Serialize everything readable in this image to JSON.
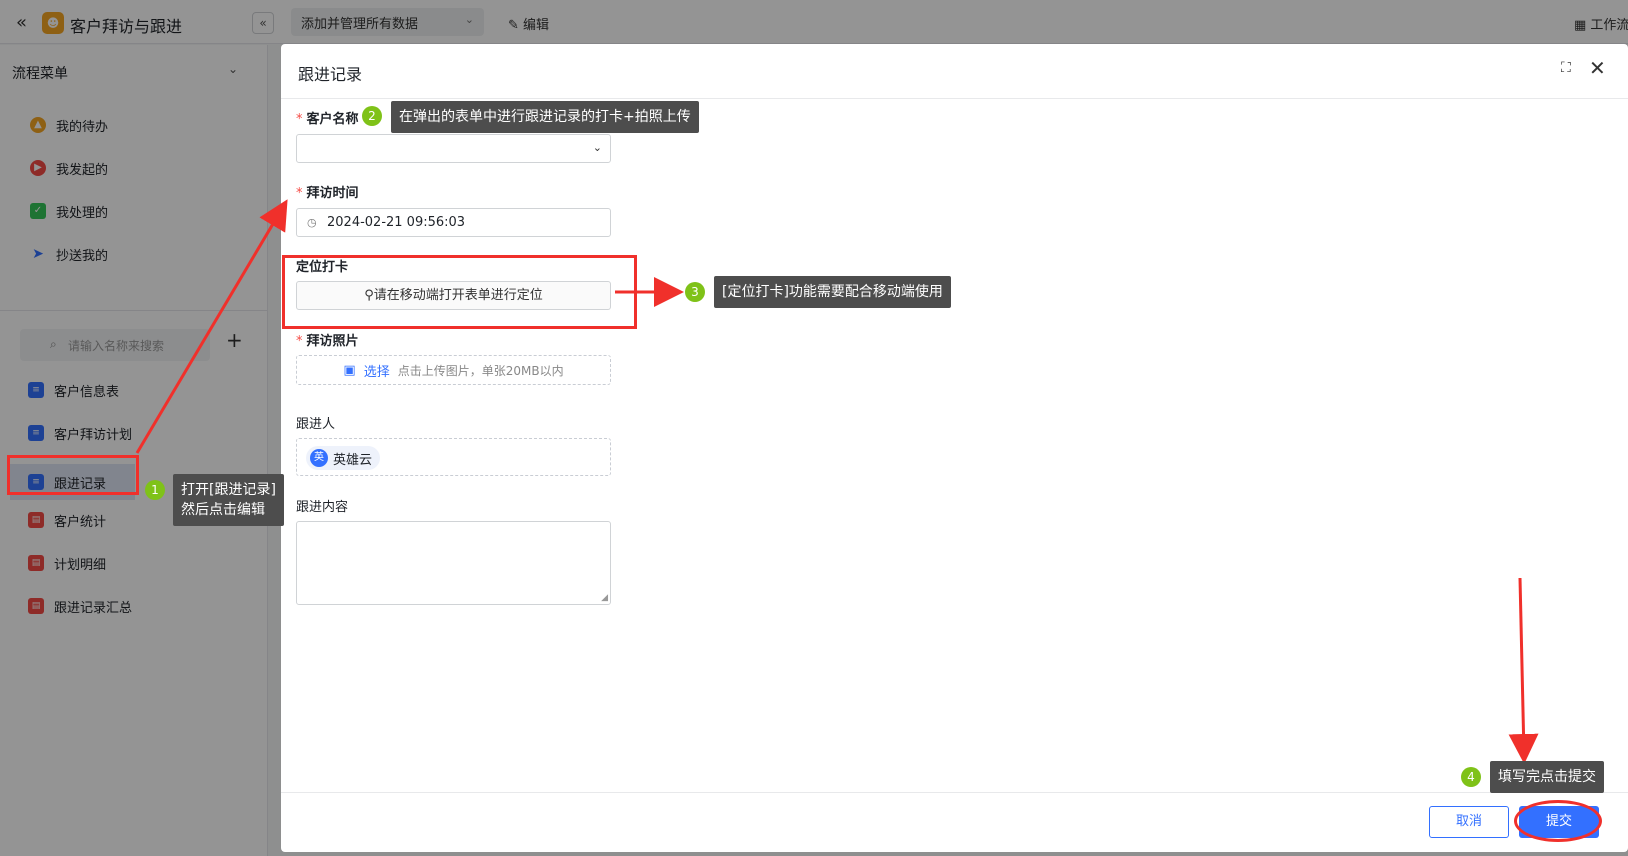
{
  "topbar": {
    "app_title": "客户拜访与跟进",
    "manage_select": "添加并管理所有数据",
    "edit_label": "编辑",
    "workflow_label": "工作流"
  },
  "sidebar": {
    "flow_menu_title": "流程菜单",
    "flow_items": [
      {
        "label": "我的待办",
        "icon": "bell-icon",
        "color": "#f5a623"
      },
      {
        "label": "我发起的",
        "icon": "play-icon",
        "color": "#f54a45"
      },
      {
        "label": "我处理的",
        "icon": "check-icon",
        "color": "#34c759"
      },
      {
        "label": "抄送我的",
        "icon": "send-icon",
        "color": "#3370ff"
      }
    ],
    "search_placeholder": "请输入名称来搜索",
    "forms": [
      {
        "label": "客户信息表",
        "icon": "document-icon"
      },
      {
        "label": "客户拜访计划",
        "icon": "document-icon"
      },
      {
        "label": "跟进记录",
        "icon": "document-icon"
      },
      {
        "label": "客户统计",
        "icon": "chart-icon"
      },
      {
        "label": "计划明细",
        "icon": "chart-icon"
      },
      {
        "label": "跟进记录汇总",
        "icon": "chart-icon"
      }
    ]
  },
  "modal": {
    "title": "跟进记录",
    "fields": {
      "customer_name_label": "客户名称",
      "visit_time_label": "拜访时间",
      "visit_time_value": "2024-02-21 09:56:03",
      "location_label": "定位打卡",
      "location_button": "请在移动端打开表单进行定位",
      "photo_label": "拜访照片",
      "photo_pick": "选择",
      "photo_hint": "点击上传图片，单张20MB以内",
      "follower_label": "跟进人",
      "follower_name": "英雄云",
      "follower_avatar": "英",
      "content_label": "跟进内容"
    },
    "cancel_label": "取消",
    "submit_label": "提交"
  },
  "annotations": {
    "step1_num": "1",
    "step1_line1": "打开[跟进记录]",
    "step1_line2": "然后点击编辑",
    "step2_num": "2",
    "step2_text": "在弹出的表单中进行跟进记录的打卡+拍照上传",
    "step3_num": "3",
    "step3_text": "[定位打卡]功能需要配合移动端使用",
    "step4_num": "4",
    "step4_text": "填写完点击提交",
    "highlight_color": "#f0302b",
    "dot_color": "#7fc218"
  }
}
